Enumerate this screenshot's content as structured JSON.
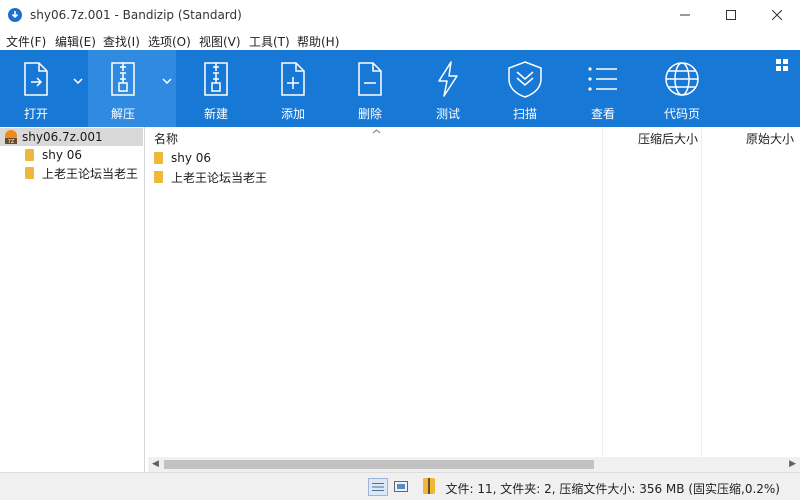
{
  "window": {
    "title": "shy06.7z.001 - Bandizip (Standard)"
  },
  "menu": [
    "文件(F)",
    "编辑(E)",
    "查找(I)",
    "选项(O)",
    "视图(V)",
    "工具(T)",
    "帮助(H)"
  ],
  "toolbar": {
    "open": "打开",
    "extract": "解压",
    "new": "新建",
    "add": "添加",
    "delete": "删除",
    "test": "测试",
    "scan": "扫描",
    "view": "查看",
    "codepage": "代码页"
  },
  "tree": {
    "root": "shy06.7z.001",
    "children": [
      "shy 06",
      "上老王论坛当老王"
    ]
  },
  "columns": {
    "name": "名称",
    "compressed": "压缩后大小",
    "original": "原始大小"
  },
  "files": [
    "shy 06",
    "上老王论坛当老王"
  ],
  "status": {
    "text": "文件: 11, 文件夹: 2, 压缩文件大小: 356 MB (固实压缩,0.2%)"
  },
  "colors": {
    "toolbar": "#1778d6",
    "folder": "#f0b83a",
    "selected": "#d9d9d9"
  }
}
